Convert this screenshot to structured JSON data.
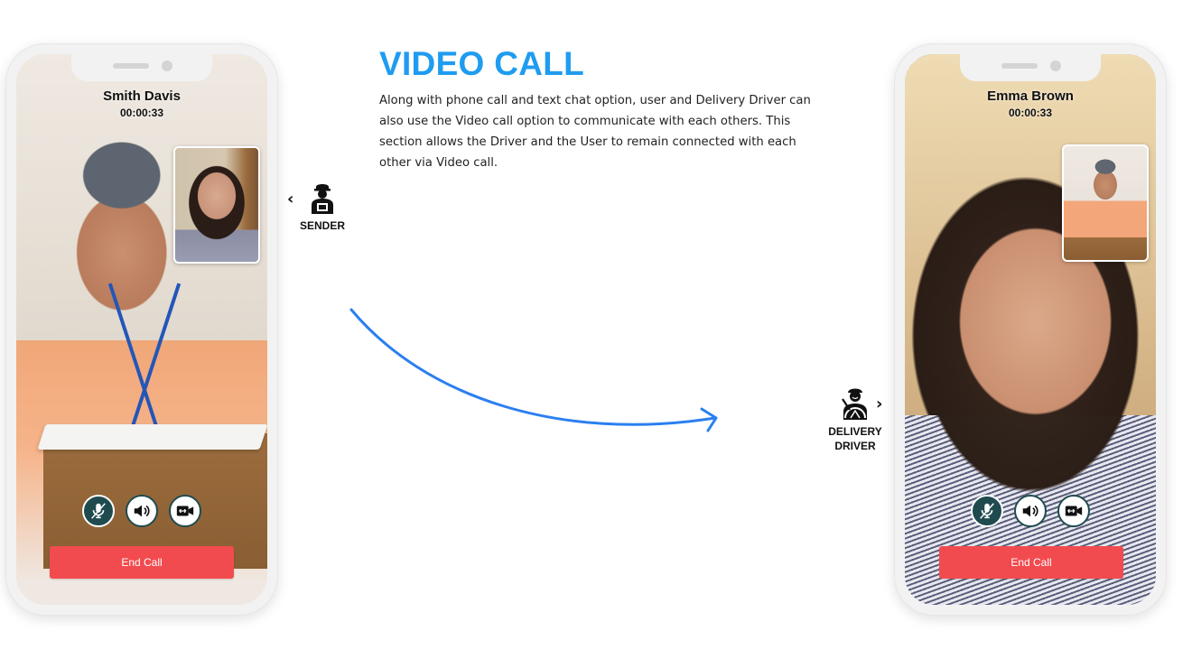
{
  "section": {
    "title": "VIDEO CALL",
    "description": "Along with phone call and text chat option, user and Delivery Driver can also use the Video call option to communicate with each others. This section allows the Driver and the User to remain connected with each other via Video call."
  },
  "roles": {
    "sender": {
      "label": "SENDER",
      "icon": "delivery-man-icon",
      "chevron": "‹"
    },
    "driver": {
      "label_line1": "DELIVERY",
      "label_line2": "DRIVER",
      "icon": "driver-steering-icon",
      "chevron": "›"
    }
  },
  "phones": [
    {
      "caller_name": "Smith Davis",
      "timer": "00:00:33",
      "controls": [
        "mic-muted-icon",
        "speaker-icon",
        "switch-camera-icon"
      ],
      "end_call_label": "End Call"
    },
    {
      "caller_name": "Emma Brown",
      "timer": "00:00:33",
      "controls": [
        "mic-muted-icon",
        "speaker-icon",
        "switch-camera-icon"
      ],
      "end_call_label": "End Call"
    }
  ],
  "colors": {
    "title": "#1f9cf0",
    "end_call": "#f24b4f",
    "control_dark": "#1f4b4f",
    "arrow": "#2b7ff0"
  }
}
